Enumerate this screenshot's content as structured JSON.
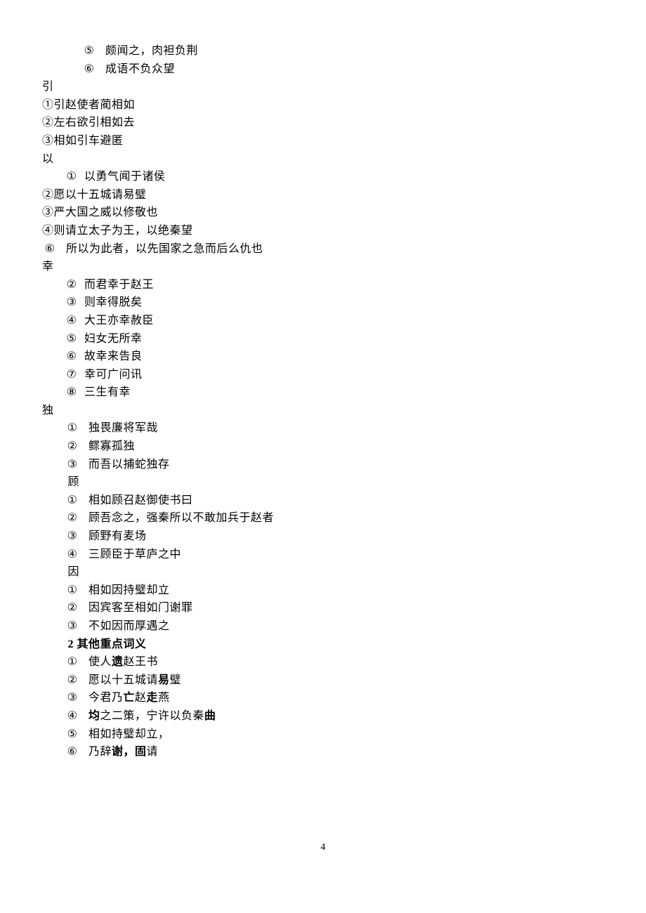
{
  "lines": [
    {
      "indent": 2,
      "marker": "⑤",
      "markerClass": "num-marker",
      "text": "颇闻之，肉袒负荆"
    },
    {
      "indent": 2,
      "marker": "⑥",
      "markerClass": "num-marker",
      "text": "成语不负众望"
    },
    {
      "indent": 0,
      "marker": "",
      "text": "引"
    },
    {
      "indent": 0,
      "marker": "",
      "text": "①引赵使者蔺相如"
    },
    {
      "indent": 0,
      "marker": "",
      "text": "②左右欲引相如去"
    },
    {
      "indent": 0,
      "marker": "",
      "text": "③相如引车避匿"
    },
    {
      "indent": 0,
      "marker": "",
      "text": "以"
    },
    {
      "indent": 1,
      "marker": "①",
      "markerClass": "circled",
      "text": "以勇气闻于诸侯"
    },
    {
      "indent": 0,
      "marker": "",
      "text": "②愿以十五城请易璧"
    },
    {
      "indent": 0,
      "marker": "",
      "text": "③严大国之威以修敬也"
    },
    {
      "indent": 0,
      "marker": "",
      "text": "④则请立太子为王，以绝秦望"
    },
    {
      "indent": 0,
      "marker": "⑥",
      "markerClass": "num-marker",
      "text": "所以为此者，以先国家之急而后么仇也"
    },
    {
      "indent": 0,
      "marker": "",
      "text": "幸"
    },
    {
      "indent": 1,
      "marker": "②",
      "markerClass": "circled",
      "text": "而君幸于赵王"
    },
    {
      "indent": 1,
      "marker": "③",
      "markerClass": "circled",
      "text": "则幸得脱矣"
    },
    {
      "indent": 1,
      "marker": "④",
      "markerClass": "circled",
      "text": "大王亦幸赦臣"
    },
    {
      "indent": 1,
      "marker": "⑤",
      "markerClass": "circled",
      "text": "妇女无所幸"
    },
    {
      "indent": 1,
      "marker": "⑥",
      "markerClass": "circled",
      "text": "故幸来告良"
    },
    {
      "indent": 1,
      "marker": "⑦",
      "markerClass": "circled",
      "text": "幸可广问讯"
    },
    {
      "indent": 1,
      "marker": "⑧",
      "markerClass": "circled",
      "text": "三生有幸"
    },
    {
      "indent": 0,
      "marker": "",
      "text": "独"
    },
    {
      "indent": 1,
      "marker": "①",
      "markerClass": "num-marker",
      "text": "独畏廉将军哉"
    },
    {
      "indent": 1,
      "marker": "②",
      "markerClass": "num-marker",
      "text": "鳏寡孤独"
    },
    {
      "indent": 1,
      "marker": "③",
      "markerClass": "num-marker",
      "text": "而吾以捕蛇独存"
    },
    {
      "indent": 1,
      "marker": "",
      "text": " 顾"
    },
    {
      "indent": 1,
      "marker": "①",
      "markerClass": "num-marker",
      "text": "相如顾召赵御使书曰"
    },
    {
      "indent": 1,
      "marker": "②",
      "markerClass": "num-marker",
      "text": "顾吾念之，强秦所以不敢加兵于赵者"
    },
    {
      "indent": 1,
      "marker": "③",
      "markerClass": "num-marker",
      "text": "顾野有麦场"
    },
    {
      "indent": 1,
      "marker": "④",
      "markerClass": "num-marker",
      "text": "三顾臣于草庐之中"
    },
    {
      "indent": 1,
      "marker": "",
      "text": " 因"
    },
    {
      "indent": 1,
      "marker": "①",
      "markerClass": "num-marker",
      "text": "相如因持璧却立"
    },
    {
      "indent": 1,
      "marker": "②",
      "markerClass": "num-marker",
      "text": "因宾客至相如门谢罪"
    },
    {
      "indent": 1,
      "marker": "③",
      "markerClass": "num-marker",
      "text": "不如因而厚遇之"
    },
    {
      "indent": 1,
      "marker": "",
      "textParts": [
        {
          "t": " 2 其他重点词义",
          "bold": true
        }
      ]
    },
    {
      "indent": 1,
      "marker": "①",
      "markerClass": "num-marker",
      "textParts": [
        {
          "t": "使人"
        },
        {
          "t": "遗",
          "bold": true
        },
        {
          "t": "赵王书"
        }
      ]
    },
    {
      "indent": 1,
      "marker": "②",
      "markerClass": "num-marker",
      "textParts": [
        {
          "t": "愿以十五城请"
        },
        {
          "t": "易",
          "bold": true
        },
        {
          "t": "璧"
        }
      ]
    },
    {
      "indent": 1,
      "marker": "③",
      "markerClass": "num-marker",
      "textParts": [
        {
          "t": "今君乃"
        },
        {
          "t": "亡",
          "bold": true
        },
        {
          "t": "赵"
        },
        {
          "t": "走",
          "bold": true
        },
        {
          "t": "燕"
        }
      ]
    },
    {
      "indent": 1,
      "marker": "④",
      "markerClass": "num-marker",
      "textParts": [
        {
          "t": "均",
          "bold": true
        },
        {
          "t": "之二策，宁许以负秦"
        },
        {
          "t": "曲",
          "bold": true
        }
      ]
    },
    {
      "indent": 1,
      "marker": "⑤",
      "markerClass": "num-marker",
      "text": "相如持璧却立，"
    },
    {
      "indent": 1,
      "marker": "⑥",
      "markerClass": "num-marker",
      "textParts": [
        {
          "t": "乃辞"
        },
        {
          "t": "谢，固",
          "bold": true
        },
        {
          "t": "请"
        }
      ]
    }
  ],
  "pageNumber": "4"
}
